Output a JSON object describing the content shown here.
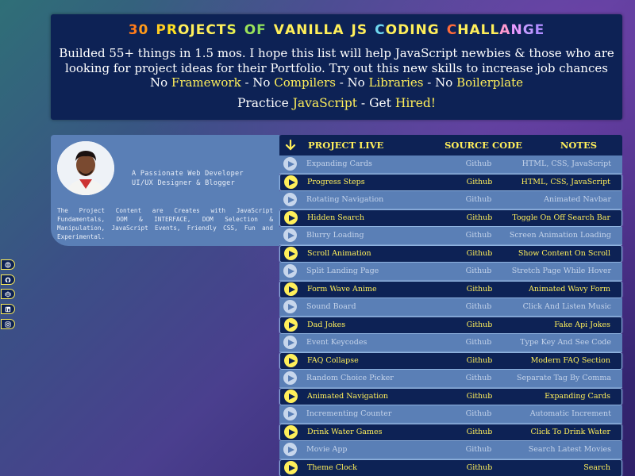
{
  "header": {
    "title_letters": [
      {
        "t": "3",
        "c": "#ff7a1a"
      },
      {
        "t": "0",
        "c": "#ff9a1a"
      },
      {
        "t": " ",
        "c": "#ffffff"
      },
      {
        "t": "P",
        "c": "#ffcc22"
      },
      {
        "t": "R",
        "c": "#ffe020"
      },
      {
        "t": "O",
        "c": "#ffef5a"
      },
      {
        "t": "J",
        "c": "#ffef5a"
      },
      {
        "t": "E",
        "c": "#ffef5a"
      },
      {
        "t": "C",
        "c": "#ffef5a"
      },
      {
        "t": "T",
        "c": "#ffef5a"
      },
      {
        "t": "S",
        "c": "#e8f050"
      },
      {
        "t": " ",
        "c": "#ffffff"
      },
      {
        "t": "O",
        "c": "#9be35a"
      },
      {
        "t": "F",
        "c": "#8cdc5c"
      },
      {
        "t": " ",
        "c": "#ffffff"
      },
      {
        "t": "V",
        "c": "#ffef5a"
      },
      {
        "t": "A",
        "c": "#ffef5a"
      },
      {
        "t": "N",
        "c": "#ffef5a"
      },
      {
        "t": "I",
        "c": "#ffef5a"
      },
      {
        "t": "L",
        "c": "#ffef5a"
      },
      {
        "t": "L",
        "c": "#ffef5a"
      },
      {
        "t": "A",
        "c": "#ffef5a"
      },
      {
        "t": " ",
        "c": "#ffffff"
      },
      {
        "t": "J",
        "c": "#ffef5a"
      },
      {
        "t": "S",
        "c": "#ffef5a"
      },
      {
        "t": " ",
        "c": "#ffffff"
      },
      {
        "t": "C",
        "c": "#6fd8f0"
      },
      {
        "t": "O",
        "c": "#ffef5a"
      },
      {
        "t": "D",
        "c": "#ffef5a"
      },
      {
        "t": "I",
        "c": "#ffef5a"
      },
      {
        "t": "N",
        "c": "#ffef5a"
      },
      {
        "t": "G",
        "c": "#ffef5a"
      },
      {
        "t": " ",
        "c": "#ffffff"
      },
      {
        "t": "C",
        "c": "#ff6a3a"
      },
      {
        "t": "H",
        "c": "#ffef5a"
      },
      {
        "t": "A",
        "c": "#ffef5a"
      },
      {
        "t": "L",
        "c": "#ffef5a"
      },
      {
        "t": "L",
        "c": "#ffef5a"
      },
      {
        "t": "A",
        "c": "#ff9ad0"
      },
      {
        "t": "N",
        "c": "#e89aff"
      },
      {
        "t": "G",
        "c": "#c09aff"
      },
      {
        "t": "E",
        "c": "#b08cff"
      }
    ],
    "desc_line1": "Builded 55+ things in 1.5 mos. I hope this list will help JavaScript newbies & those who are",
    "desc_line2": "looking for project ideas for their Portfolio. Try out this new skills to increase job chances",
    "no_prefix": "No",
    "framework": "Framework",
    "dash_no": "- No",
    "compilers": "Compilers",
    "libraries": "Libraries",
    "boilerplate": "Boilerplate",
    "practice": "Practice",
    "javascript": "JavaScript",
    "get": "- Get",
    "hired": "Hired!"
  },
  "profile": {
    "tagline": "A Passionate Web Developer UI/UX Designer & Blogger",
    "about": "The Project Content are Creates with JavaScript Fundamentals, DOM & INTERFACE, DOM Selection & Manipulation, JavaScript Events, Friendly CSS, Fun and Experimental."
  },
  "social": [
    {
      "icon": "globe-icon"
    },
    {
      "icon": "github-icon"
    },
    {
      "icon": "codepen-icon"
    },
    {
      "icon": "linkedin-icon"
    },
    {
      "icon": "instagram-icon"
    }
  ],
  "table": {
    "col_project": "PROJECT LIVE",
    "col_source": "SOURCE CODE",
    "col_notes": "NOTES",
    "rows": [
      {
        "name": "Expanding Cards",
        "src": "Github",
        "note": "HTML, CSS, JavaScript",
        "style": "light"
      },
      {
        "name": "Progress Steps",
        "src": "Github",
        "note": "HTML, CSS, JavaScript",
        "style": "dark"
      },
      {
        "name": "Rotating Navigation",
        "src": "Github",
        "note": "Animated Navbar",
        "style": "light"
      },
      {
        "name": "Hidden Search",
        "src": "Github",
        "note": "Toggle On Off Search Bar",
        "style": "dark"
      },
      {
        "name": "Blurry Loading",
        "src": "Github",
        "note": "Screen Animation Loading",
        "style": "light"
      },
      {
        "name": "Scroll Animation",
        "src": "Github",
        "note": "Show Content On Scroll",
        "style": "dark"
      },
      {
        "name": "Split Landing Page",
        "src": "Github",
        "note": "Stretch Page While Hover",
        "style": "light"
      },
      {
        "name": "Form Wave Anime",
        "src": "Github",
        "note": "Animated Wavy Form",
        "style": "dark"
      },
      {
        "name": "Sound Board",
        "src": "Github",
        "note": "Click And Listen Music",
        "style": "light"
      },
      {
        "name": "Dad Jokes",
        "src": "Github",
        "note": "Fake Api Jokes",
        "style": "dark"
      },
      {
        "name": "Event Keycodes",
        "src": "Github",
        "note": "Type Key And See Code",
        "style": "light"
      },
      {
        "name": "FAQ Collapse",
        "src": "Github",
        "note": "Modern FAQ Section",
        "style": "dark"
      },
      {
        "name": "Random Choice Picker",
        "src": "Github",
        "note": "Separate Tag By Comma",
        "style": "light"
      },
      {
        "name": "Animated Navigation",
        "src": "Github",
        "note": "Expanding Cards",
        "style": "dark"
      },
      {
        "name": "Incrementing Counter",
        "src": "Github",
        "note": "Automatic Increment",
        "style": "light"
      },
      {
        "name": "Drink Water Games",
        "src": "Github",
        "note": "Click To Drink Water",
        "style": "dark"
      },
      {
        "name": "Movie App",
        "src": "Github",
        "note": "Search Latest Movies",
        "style": "light"
      },
      {
        "name": "Theme Clock",
        "src": "Github",
        "note": "Search",
        "style": "dark"
      }
    ]
  }
}
